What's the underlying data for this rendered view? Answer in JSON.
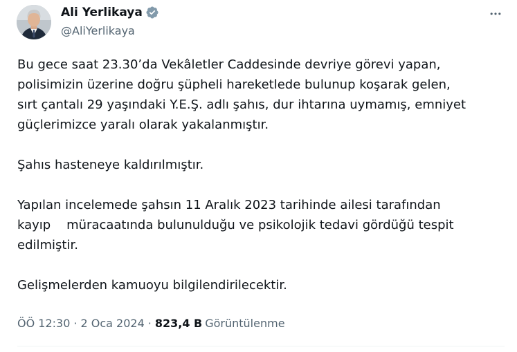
{
  "author": {
    "display_name": "Ali Yerlikaya",
    "handle": "@AliYerlikaya",
    "verified_icon": "verified-badge-icon",
    "verified_color": "#829aab",
    "avatar": "profile-photo"
  },
  "menu": {
    "icon": "more-horizontal-icon"
  },
  "tweet": {
    "paragraphs": [
      {
        "lines": [
          "Bu gece saat 23.30’da Vekâletler Caddesinde devriye görevi yapan,",
          "polisimizin üzerine doğru şüpheli hareketlede bulunup koşarak gelen,",
          "sırt çantalı 29 yaşındaki Y.E.Ş. adlı şahıs, dur ihtarına uymamış, emniyet",
          "güçlerimizce yaralı olarak yakalanmıştır."
        ]
      },
      {
        "lines": [
          "Şahıs hasteneye kaldırılmıştır."
        ]
      },
      {
        "lines": [
          "Yapılan incelemede şahsın 11 Aralık 2023 tarihinde ailesi tarafından",
          "kayıp    müracaatında bulunulduğu ve psikolojik tedavi gördüğü tespit",
          "edilmiştir."
        ]
      },
      {
        "lines": [
          "Gelişmelerden kamuoyu bilgilendirilecektir."
        ]
      }
    ]
  },
  "meta": {
    "time": "ÖÖ 12:30",
    "separator": "·",
    "date": "2 Oca 2024",
    "views_count": "823,4 B",
    "views_label": "Görüntülenme"
  },
  "colors": {
    "text": "#0f1419",
    "secondary": "#536471",
    "divider": "#eff3f4"
  }
}
